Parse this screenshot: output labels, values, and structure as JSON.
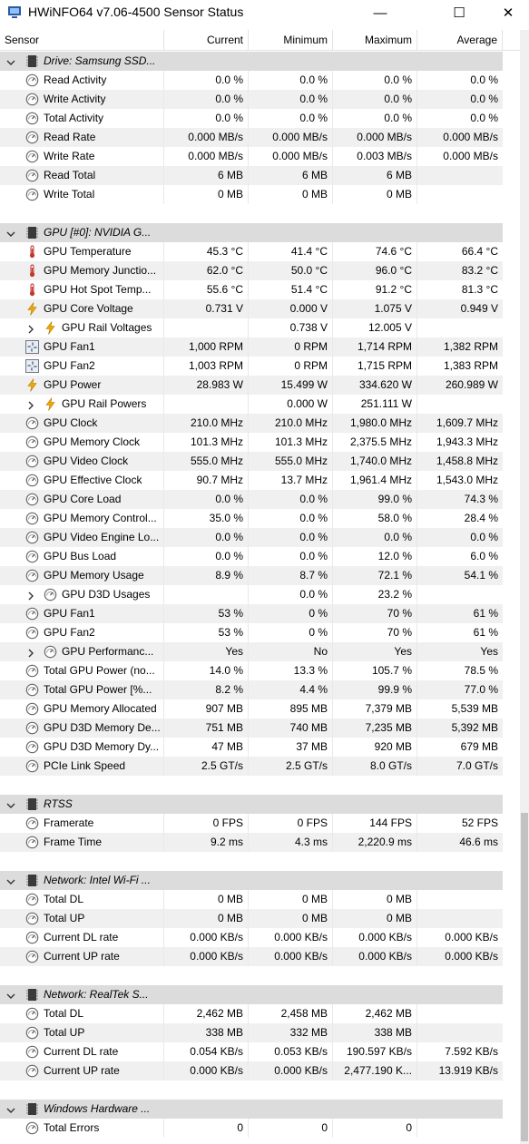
{
  "window": {
    "title": "HWiNFO64 v7.06-4500 Sensor Status",
    "minimize_glyph": "—",
    "maximize_glyph": "☐",
    "close_glyph": "✕"
  },
  "columns": {
    "sensor": "Sensor",
    "current": "Current",
    "minimum": "Minimum",
    "maximum": "Maximum",
    "average": "Average"
  },
  "rows": [
    {
      "type": "group",
      "label": "Drive: Samsung SSD..."
    },
    {
      "type": "item",
      "icon": "gauge-icon",
      "label": "Read Activity",
      "cur": "0.0 %",
      "min": "0.0 %",
      "max": "0.0 %",
      "avg": "0.0 %"
    },
    {
      "type": "item",
      "icon": "gauge-icon",
      "label": "Write Activity",
      "cur": "0.0 %",
      "min": "0.0 %",
      "max": "0.0 %",
      "avg": "0.0 %"
    },
    {
      "type": "item",
      "icon": "gauge-icon",
      "label": "Total Activity",
      "cur": "0.0 %",
      "min": "0.0 %",
      "max": "0.0 %",
      "avg": "0.0 %"
    },
    {
      "type": "item",
      "icon": "gauge-icon",
      "label": "Read Rate",
      "cur": "0.000 MB/s",
      "min": "0.000 MB/s",
      "max": "0.000 MB/s",
      "avg": "0.000 MB/s"
    },
    {
      "type": "item",
      "icon": "gauge-icon",
      "label": "Write Rate",
      "cur": "0.000 MB/s",
      "min": "0.000 MB/s",
      "max": "0.003 MB/s",
      "avg": "0.000 MB/s"
    },
    {
      "type": "item",
      "icon": "gauge-icon",
      "label": "Read Total",
      "cur": "6 MB",
      "min": "6 MB",
      "max": "6 MB",
      "avg": ""
    },
    {
      "type": "item",
      "icon": "gauge-icon",
      "label": "Write Total",
      "cur": "0 MB",
      "min": "0 MB",
      "max": "0 MB",
      "avg": ""
    },
    {
      "type": "spacer"
    },
    {
      "type": "group",
      "label": "GPU [#0]: NVIDIA G..."
    },
    {
      "type": "item",
      "icon": "thermometer-icon",
      "label": "GPU Temperature",
      "cur": "45.3 °C",
      "min": "41.4 °C",
      "max": "74.6 °C",
      "avg": "66.4 °C"
    },
    {
      "type": "item",
      "icon": "thermometer-icon",
      "label": "GPU Memory Junctio...",
      "cur": "62.0 °C",
      "min": "50.0 °C",
      "max": "96.0 °C",
      "avg": "83.2 °C"
    },
    {
      "type": "item",
      "icon": "thermometer-icon",
      "label": "GPU Hot Spot Temp...",
      "cur": "55.6 °C",
      "min": "51.4 °C",
      "max": "91.2 °C",
      "avg": "81.3 °C"
    },
    {
      "type": "item",
      "icon": "lightning-icon",
      "label": "GPU Core Voltage",
      "cur": "0.731 V",
      "min": "0.000 V",
      "max": "1.075 V",
      "avg": "0.949 V"
    },
    {
      "type": "sub",
      "icon": "lightning-icon",
      "label": "GPU Rail Voltages",
      "cur": "",
      "min": "0.738 V",
      "max": "12.005 V",
      "avg": ""
    },
    {
      "type": "item",
      "icon": "fan-icon",
      "label": "GPU Fan1",
      "cur": "1,000 RPM",
      "min": "0 RPM",
      "max": "1,714 RPM",
      "avg": "1,382 RPM"
    },
    {
      "type": "item",
      "icon": "fan-icon",
      "label": "GPU Fan2",
      "cur": "1,003 RPM",
      "min": "0 RPM",
      "max": "1,715 RPM",
      "avg": "1,383 RPM"
    },
    {
      "type": "item",
      "icon": "lightning-icon",
      "label": "GPU Power",
      "cur": "28.983 W",
      "min": "15.499 W",
      "max": "334.620 W",
      "avg": "260.989 W"
    },
    {
      "type": "sub",
      "icon": "lightning-icon",
      "label": "GPU Rail Powers",
      "cur": "",
      "min": "0.000 W",
      "max": "251.111 W",
      "avg": ""
    },
    {
      "type": "item",
      "icon": "gauge-icon",
      "label": "GPU Clock",
      "cur": "210.0 MHz",
      "min": "210.0 MHz",
      "max": "1,980.0 MHz",
      "avg": "1,609.7 MHz"
    },
    {
      "type": "item",
      "icon": "gauge-icon",
      "label": "GPU Memory Clock",
      "cur": "101.3 MHz",
      "min": "101.3 MHz",
      "max": "2,375.5 MHz",
      "avg": "1,943.3 MHz"
    },
    {
      "type": "item",
      "icon": "gauge-icon",
      "label": "GPU Video Clock",
      "cur": "555.0 MHz",
      "min": "555.0 MHz",
      "max": "1,740.0 MHz",
      "avg": "1,458.8 MHz"
    },
    {
      "type": "item",
      "icon": "gauge-icon",
      "label": "GPU Effective Clock",
      "cur": "90.7 MHz",
      "min": "13.7 MHz",
      "max": "1,961.4 MHz",
      "avg": "1,543.0 MHz"
    },
    {
      "type": "item",
      "icon": "gauge-icon",
      "label": "GPU Core Load",
      "cur": "0.0 %",
      "min": "0.0 %",
      "max": "99.0 %",
      "avg": "74.3 %"
    },
    {
      "type": "item",
      "icon": "gauge-icon",
      "label": "GPU Memory Control...",
      "cur": "35.0 %",
      "min": "0.0 %",
      "max": "58.0 %",
      "avg": "28.4 %"
    },
    {
      "type": "item",
      "icon": "gauge-icon",
      "label": "GPU Video Engine Lo...",
      "cur": "0.0 %",
      "min": "0.0 %",
      "max": "0.0 %",
      "avg": "0.0 %"
    },
    {
      "type": "item",
      "icon": "gauge-icon",
      "label": "GPU Bus Load",
      "cur": "0.0 %",
      "min": "0.0 %",
      "max": "12.0 %",
      "avg": "6.0 %"
    },
    {
      "type": "item",
      "icon": "gauge-icon",
      "label": "GPU Memory Usage",
      "cur": "8.9 %",
      "min": "8.7 %",
      "max": "72.1 %",
      "avg": "54.1 %"
    },
    {
      "type": "sub",
      "icon": "gauge-icon",
      "label": "GPU D3D Usages",
      "cur": "",
      "min": "0.0 %",
      "max": "23.2 %",
      "avg": ""
    },
    {
      "type": "item",
      "icon": "gauge-icon",
      "label": "GPU Fan1",
      "cur": "53 %",
      "min": "0 %",
      "max": "70 %",
      "avg": "61 %"
    },
    {
      "type": "item",
      "icon": "gauge-icon",
      "label": "GPU Fan2",
      "cur": "53 %",
      "min": "0 %",
      "max": "70 %",
      "avg": "61 %"
    },
    {
      "type": "sub",
      "icon": "gauge-icon",
      "label": "GPU Performanc...",
      "cur": "Yes",
      "min": "No",
      "max": "Yes",
      "avg": "Yes"
    },
    {
      "type": "item",
      "icon": "gauge-icon",
      "label": "Total GPU Power (no...",
      "cur": "14.0 %",
      "min": "13.3 %",
      "max": "105.7 %",
      "avg": "78.5 %"
    },
    {
      "type": "item",
      "icon": "gauge-icon",
      "label": "Total GPU Power [%...",
      "cur": "8.2 %",
      "min": "4.4 %",
      "max": "99.9 %",
      "avg": "77.0 %"
    },
    {
      "type": "item",
      "icon": "gauge-icon",
      "label": "GPU Memory Allocated",
      "cur": "907 MB",
      "min": "895 MB",
      "max": "7,379 MB",
      "avg": "5,539 MB"
    },
    {
      "type": "item",
      "icon": "gauge-icon",
      "label": "GPU D3D Memory De...",
      "cur": "751 MB",
      "min": "740 MB",
      "max": "7,235 MB",
      "avg": "5,392 MB"
    },
    {
      "type": "item",
      "icon": "gauge-icon",
      "label": "GPU D3D Memory Dy...",
      "cur": "47 MB",
      "min": "37 MB",
      "max": "920 MB",
      "avg": "679 MB"
    },
    {
      "type": "item",
      "icon": "gauge-icon",
      "label": "PCIe Link Speed",
      "cur": "2.5 GT/s",
      "min": "2.5 GT/s",
      "max": "8.0 GT/s",
      "avg": "7.0 GT/s"
    },
    {
      "type": "spacer"
    },
    {
      "type": "group",
      "label": "RTSS"
    },
    {
      "type": "item",
      "icon": "gauge-icon",
      "label": "Framerate",
      "cur": "0 FPS",
      "min": "0 FPS",
      "max": "144 FPS",
      "avg": "52 FPS"
    },
    {
      "type": "item",
      "icon": "gauge-icon",
      "label": "Frame Time",
      "cur": "9.2 ms",
      "min": "4.3 ms",
      "max": "2,220.9 ms",
      "avg": "46.6 ms"
    },
    {
      "type": "spacer"
    },
    {
      "type": "group",
      "label": "Network: Intel Wi-Fi ..."
    },
    {
      "type": "item",
      "icon": "gauge-icon",
      "label": "Total DL",
      "cur": "0 MB",
      "min": "0 MB",
      "max": "0 MB",
      "avg": ""
    },
    {
      "type": "item",
      "icon": "gauge-icon",
      "label": "Total UP",
      "cur": "0 MB",
      "min": "0 MB",
      "max": "0 MB",
      "avg": ""
    },
    {
      "type": "item",
      "icon": "gauge-icon",
      "label": "Current DL rate",
      "cur": "0.000 KB/s",
      "min": "0.000 KB/s",
      "max": "0.000 KB/s",
      "avg": "0.000 KB/s"
    },
    {
      "type": "item",
      "icon": "gauge-icon",
      "label": "Current UP rate",
      "cur": "0.000 KB/s",
      "min": "0.000 KB/s",
      "max": "0.000 KB/s",
      "avg": "0.000 KB/s"
    },
    {
      "type": "spacer"
    },
    {
      "type": "group",
      "label": "Network: RealTek S..."
    },
    {
      "type": "item",
      "icon": "gauge-icon",
      "label": "Total DL",
      "cur": "2,462 MB",
      "min": "2,458 MB",
      "max": "2,462 MB",
      "avg": ""
    },
    {
      "type": "item",
      "icon": "gauge-icon",
      "label": "Total UP",
      "cur": "338 MB",
      "min": "332 MB",
      "max": "338 MB",
      "avg": ""
    },
    {
      "type": "item",
      "icon": "gauge-icon",
      "label": "Current DL rate",
      "cur": "0.054 KB/s",
      "min": "0.053 KB/s",
      "max": "190.597 KB/s",
      "avg": "7.592 KB/s"
    },
    {
      "type": "item",
      "icon": "gauge-icon",
      "label": "Current UP rate",
      "cur": "0.000 KB/s",
      "min": "0.000 KB/s",
      "max": "2,477.190 K...",
      "avg": "13.919 KB/s"
    },
    {
      "type": "spacer"
    },
    {
      "type": "group",
      "label": "Windows Hardware ..."
    },
    {
      "type": "item",
      "icon": "gauge-icon",
      "label": "Total Errors",
      "cur": "0",
      "min": "0",
      "max": "0",
      "avg": ""
    }
  ],
  "colors": {
    "group_row": "#dcdcdc",
    "alt_row": "#f0f0f0",
    "thermometer": "#c0392b",
    "lightning": "#f0a800",
    "chip": "#3a3a3a"
  }
}
